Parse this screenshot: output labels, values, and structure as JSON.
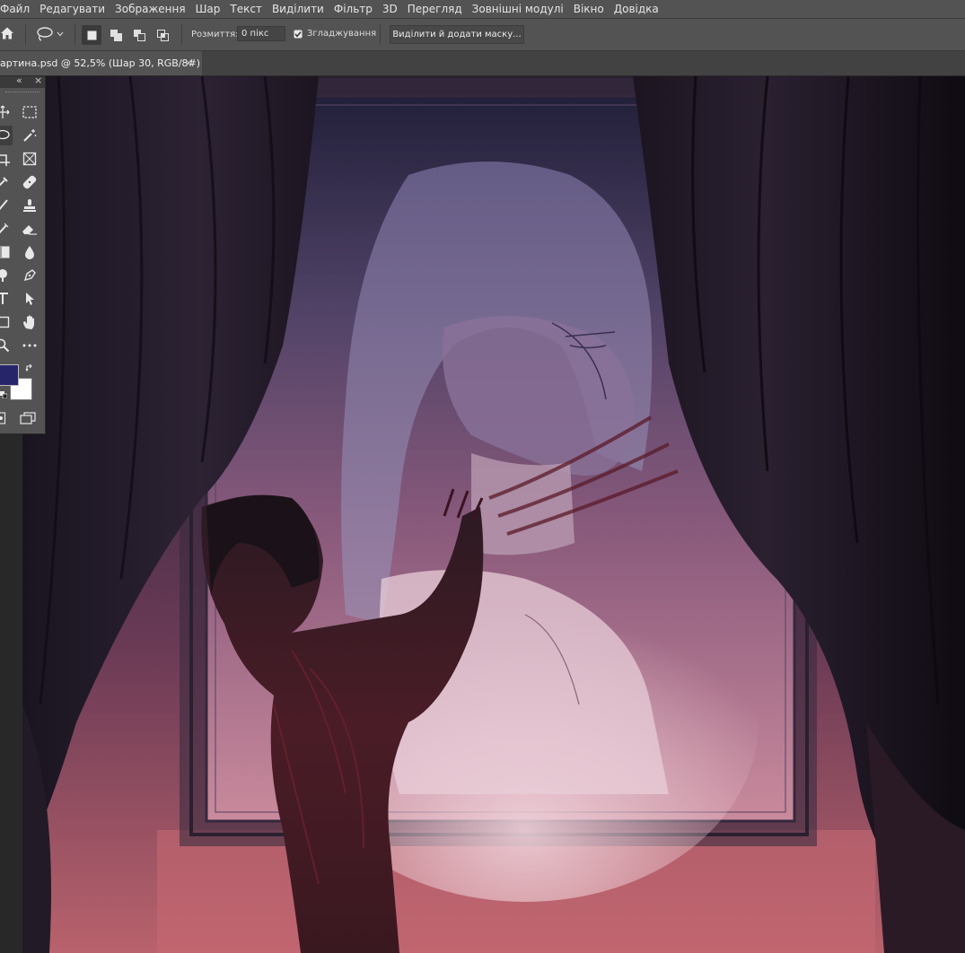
{
  "menubar": {
    "items": [
      "Файл",
      "Редагувати",
      "Зображення",
      "Шар",
      "Текст",
      "Виділити",
      "Фільтр",
      "3D",
      "Перегляд",
      "Зовнішні модулі",
      "Вікно",
      "Довідка"
    ]
  },
  "options_bar": {
    "feather_label": "Розмиття:",
    "feather_value": "0 пікс",
    "antialias_label": "Згладжування",
    "antialias_checked": true,
    "select_mask_label": "Виділити й додати маску..."
  },
  "document": {
    "tab_title": "артина.psd @ 52,5% (Шар 30, RGB/8#)",
    "close_glyph": "×"
  },
  "toolbar": {
    "collapse_glyph": "«",
    "close_glyph": "×",
    "foreground_color": "#27256a",
    "background_color": "#ffffff"
  },
  "icons": [
    "home-icon",
    "lasso-icon",
    "chevron-down-icon",
    "new-selection-icon",
    "add-selection-icon",
    "subtract-selection-icon",
    "intersect-selection-icon",
    "checkbox-icon",
    "close-icon",
    "move-icon",
    "marquee-icon",
    "magic-wand-icon",
    "crop-icon",
    "frame-icon",
    "eyedropper-icon",
    "healing-brush-icon",
    "brush-icon",
    "clone-stamp-icon",
    "eraser-icon",
    "gradient-icon",
    "blur-icon",
    "dodge-icon",
    "pen-icon",
    "type-icon",
    "path-select-icon",
    "rectangle-icon",
    "hand-icon",
    "zoom-icon",
    "more-icon",
    "swap-colors-icon",
    "default-colors-icon",
    "quick-mask-icon",
    "screen-mode-icon"
  ]
}
